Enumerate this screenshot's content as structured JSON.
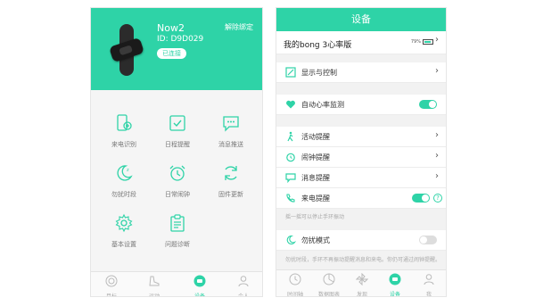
{
  "left": {
    "device": {
      "name": "Now2",
      "id": "ID: D9D029",
      "status": "已连接",
      "unbind": "解除绑定"
    },
    "grid": [
      {
        "label": "来电识别",
        "icon": "phone-touch-icon"
      },
      {
        "label": "日程提醒",
        "icon": "calendar-check-icon"
      },
      {
        "label": "消息推送",
        "icon": "message-bubble-icon"
      },
      {
        "label": "勿扰时段",
        "icon": "moon-icon"
      },
      {
        "label": "日常闹钟",
        "icon": "alarm-clock-icon"
      },
      {
        "label": "固件更新",
        "icon": "refresh-icon"
      },
      {
        "label": "基本设置",
        "icon": "gear-icon"
      },
      {
        "label": "问题诊断",
        "icon": "clipboard-icon"
      }
    ],
    "tabs": [
      {
        "label": "目标",
        "icon": "target-icon",
        "active": false
      },
      {
        "label": "运动",
        "icon": "shoe-icon",
        "active": false
      },
      {
        "label": "设备",
        "icon": "device-icon",
        "active": true
      },
      {
        "label": "个人",
        "icon": "person-icon",
        "active": false
      }
    ]
  },
  "right": {
    "title": "设备",
    "mybong": "我的bong 3心率版",
    "battery_text": "79%",
    "rows": {
      "display": "显示与控制",
      "auto_hr": "自动心率监测",
      "activity": "活动提醒",
      "alarm": "闹钟提醒",
      "message": "消息提醒",
      "call": "来电提醒"
    },
    "hint_call": "摇一摇可以停止手环振动",
    "dnd": "勿扰模式",
    "hint_dnd": "勿扰时段，手环不再振动提醒消息和来电。你仍可通过闹钟提醒。",
    "tabs": [
      {
        "label": "时间轴",
        "icon": "clock-icon",
        "active": false
      },
      {
        "label": "数据图表",
        "icon": "chart-icon",
        "active": false
      },
      {
        "label": "发现",
        "icon": "pinwheel-icon",
        "active": false
      },
      {
        "label": "设备",
        "icon": "device-icon",
        "active": true
      },
      {
        "label": "我",
        "icon": "person-icon",
        "active": false
      }
    ]
  },
  "colors": {
    "accent": "#2ed3a7",
    "background": "#f2f2f2"
  }
}
